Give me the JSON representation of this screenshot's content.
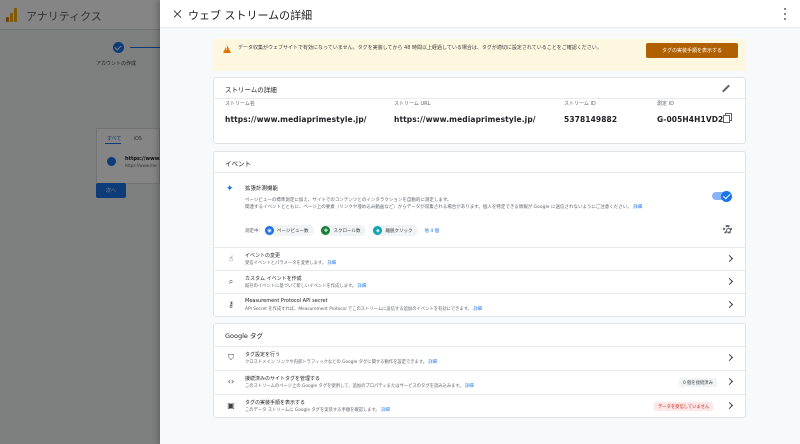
{
  "background": {
    "app_title": "アナリティクス",
    "step_label": "アカウントの作成",
    "tabs": [
      "すべて",
      "iOS"
    ],
    "stream_url": "https://www.m",
    "stream_sub": "https://www.me",
    "next_button": "次へ"
  },
  "panel": {
    "title": "ウェブ ストリームの詳細"
  },
  "warning": {
    "text": "データ収集がウェブサイトで有効になっていません。タグを実装してから 48 時間以上経過している場合は、タグが適切に設定されていることをご確認ください。",
    "button": "タグの実装手順を表示する"
  },
  "stream_details": {
    "title": "ストリームの詳細",
    "columns": [
      {
        "label": "ストリーム名",
        "value": "https://www.mediaprimestyle.jp/"
      },
      {
        "label": "ストリーム URL",
        "value": "https://www.mediaprimestyle.jp/"
      },
      {
        "label": "ストリーム ID",
        "value": "5378149882"
      },
      {
        "label": "測定 ID",
        "value": "G-005H4H1VD2"
      }
    ]
  },
  "events": {
    "title": "イベント",
    "enhanced": {
      "title": "拡張計測機能",
      "desc1": "ページビューの標準測定に加え、サイトでのコンテンツとのインタラクションを自動的に測定します。",
      "desc2": "関連するイベントとともに、ページ上の要素（リンクや埋め込み動画など）からデータが収集される場合があります。個人を特定できる情報が Google に送信されないようにご注意ください。",
      "desc_link": "詳細",
      "measuring_label": "測定中:",
      "chips": [
        {
          "icon": "page-view-icon",
          "label": "ページビュー数",
          "color": "#1a73e8",
          "glyph": "◉"
        },
        {
          "icon": "scroll-icon",
          "label": "スクロール数",
          "color": "#188038",
          "glyph": "✥"
        },
        {
          "icon": "outbound-click-icon",
          "label": "離脱クリック",
          "color": "#12a4af",
          "glyph": "◈"
        }
      ],
      "more": "他 4 個",
      "accent": "#1a73e8"
    },
    "rows": [
      {
        "title": "イベントの変更",
        "desc": "受信イベントとパラメータを変更します。",
        "link": "詳細",
        "icon": "touch-icon",
        "glyph": "☝"
      },
      {
        "title": "カスタム イベントを作成",
        "desc": "既存のイベントに基づいて新しいイベントを作成します。",
        "link": "詳細",
        "icon": "sparkle-cursor-icon",
        "glyph": "⌕"
      },
      {
        "title": "Measurement Protocol API secret",
        "desc": "API Secret を作成すれば、Measurement Protocol でこのストリームに送信する追加のイベントを有効にできます。",
        "link": "詳細",
        "icon": "key-icon",
        "glyph": "⚷"
      }
    ]
  },
  "google_tag": {
    "title": "Google タグ",
    "rows": [
      {
        "title": "タグ設定を行う",
        "desc": "クロスドメイン リンクや内部トラフィックなどの Google タグに関する動作を設定できます。",
        "link": "詳細",
        "icon": "tag-icon",
        "glyph": "⛉"
      },
      {
        "title": "接続済みのサイトタグを管理する",
        "desc": "このストリームのページ上の Google タグを使用して、追加のプロパティまたはサービスのタグを読み込みます。",
        "link": "詳細",
        "icon": "code-icon",
        "glyph": "‹›",
        "badge": "0 個を接続済み",
        "badge_bg": "#f1f3f4",
        "badge_fg": "#3c4043"
      },
      {
        "title": "タグの実装手順を表示する",
        "desc": "このデータ ストリームに Google タグを実装する手順を確認します。",
        "link": "詳細",
        "icon": "instructions-icon",
        "glyph": "▣",
        "badge": "データを受信していません",
        "badge_bg": "#fce8e6",
        "badge_fg": "#c5221f"
      }
    ]
  }
}
